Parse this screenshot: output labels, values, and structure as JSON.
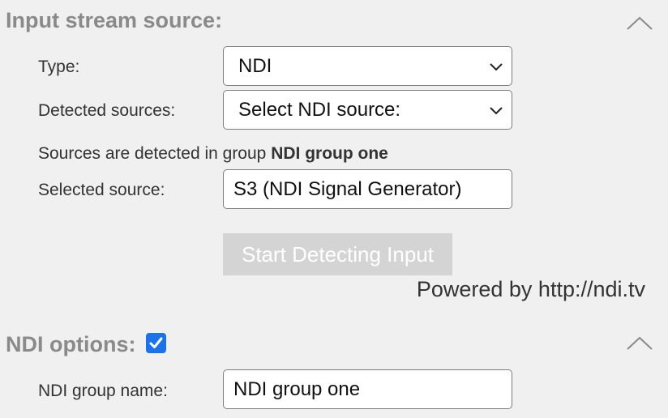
{
  "input_section": {
    "title": "Input stream source:",
    "type_label": "Type:",
    "type_value": "NDI",
    "detected_label": "Detected sources:",
    "detected_value": "Select NDI source:",
    "info_prefix": "Sources are detected in group ",
    "info_group": "NDI group one",
    "selected_label": "Selected source:",
    "selected_value": "S3 (NDI Signal Generator)",
    "start_button": "Start Detecting Input",
    "powered_by": "Powered by http://ndi.tv"
  },
  "ndi_section": {
    "title": "NDI options:",
    "enabled": true,
    "group_label": "NDI group name:",
    "group_value": "NDI group one"
  },
  "colors": {
    "background": "#f0f0f0",
    "section_title": "#8a8a8a",
    "checkbox_accent": "#1a73e8",
    "disabled_button": "#d4d4d4"
  },
  "icons": {
    "collapse": "chevron-up-icon",
    "dropdown": "chevron-down-icon",
    "check": "checkmark-icon"
  }
}
